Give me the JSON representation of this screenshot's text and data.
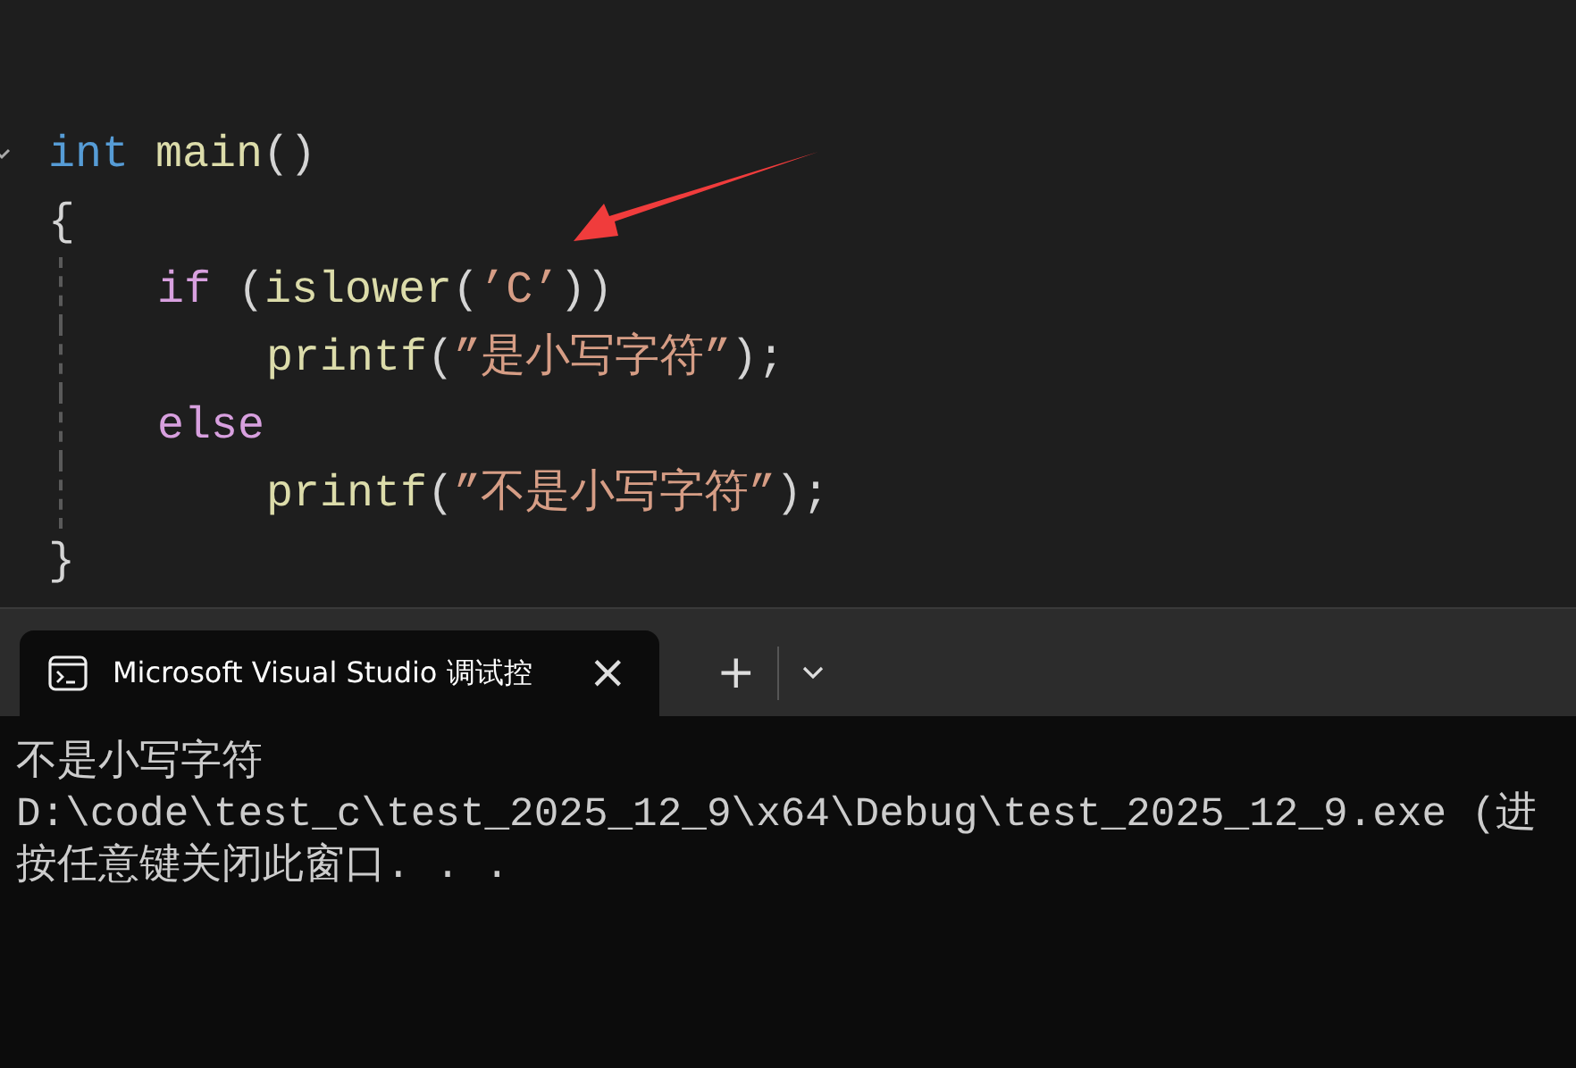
{
  "editor": {
    "lines": [
      {
        "kind": "top",
        "fold": true,
        "tokens": [
          {
            "kind": "type",
            "text": "int "
          },
          {
            "kind": "func",
            "text": "main"
          },
          {
            "kind": "punct",
            "text": "()"
          }
        ]
      },
      {
        "kind": "top",
        "fold": false,
        "tokens": [
          {
            "kind": "punct",
            "text": "{"
          }
        ]
      },
      {
        "kind": "body",
        "fold": false,
        "tokens": [
          {
            "kind": "control",
            "text": "if "
          },
          {
            "kind": "punct",
            "text": "("
          },
          {
            "kind": "func",
            "text": "islower"
          },
          {
            "kind": "punct",
            "text": "("
          },
          {
            "kind": "string",
            "text": "’C’"
          },
          {
            "kind": "punct",
            "text": "))"
          }
        ]
      },
      {
        "kind": "nested",
        "fold": false,
        "tokens": [
          {
            "kind": "func",
            "text": "printf"
          },
          {
            "kind": "punct",
            "text": "("
          },
          {
            "kind": "string",
            "text": "”是小写字符”"
          },
          {
            "kind": "punct",
            "text": ");"
          }
        ]
      },
      {
        "kind": "body",
        "fold": false,
        "tokens": [
          {
            "kind": "control",
            "text": "else"
          }
        ]
      },
      {
        "kind": "nested",
        "fold": false,
        "tokens": [
          {
            "kind": "func",
            "text": "printf"
          },
          {
            "kind": "punct",
            "text": "("
          },
          {
            "kind": "string",
            "text": "”不是小写字符”"
          },
          {
            "kind": "punct",
            "text": ");"
          }
        ]
      },
      {
        "kind": "top",
        "fold": false,
        "tokens": [
          {
            "kind": "punct",
            "text": "}"
          }
        ]
      }
    ]
  },
  "terminal": {
    "tabs": [
      {
        "title": "Microsoft Visual Studio 调试控",
        "selected": true,
        "close": "×"
      }
    ],
    "new_tab": "+",
    "output": [
      "不是小写字符",
      "D:\\code\\test_c\\test_2025_12_9\\x64\\Debug\\test_2025_12_9.exe (进",
      "按任意键关闭此窗口. . ."
    ]
  }
}
